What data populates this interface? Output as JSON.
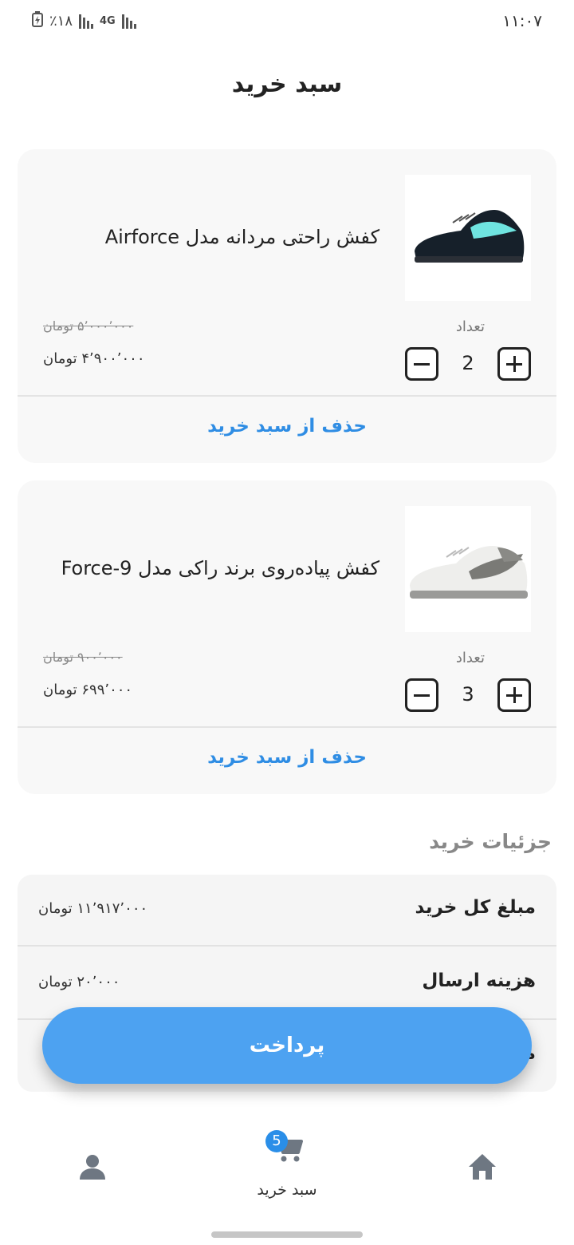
{
  "status_bar": {
    "time": "۱۱:۰۷",
    "battery": "٪۱۸",
    "network": "4G"
  },
  "page_title": "سبد خرید",
  "cart_items": [
    {
      "name": "کفش راحتی مردانه مدل Airforce",
      "quantity_label": "تعداد",
      "quantity": "2",
      "old_price": "۵٬۰۰۰٬۰۰۰ تومان",
      "new_price": "۴٬۹۰۰٬۰۰۰ تومان",
      "remove_label": "حذف از سبد خرید",
      "image_icon": "black-sneaker-icon"
    },
    {
      "name": "کفش پیاده‌روی برند راکی مدل Force-9",
      "quantity_label": "تعداد",
      "quantity": "3",
      "old_price": "۹۰۰٬۰۰۰ تومان",
      "new_price": "۶۹۹٬۰۰۰ تومان",
      "remove_label": "حذف از سبد خرید",
      "image_icon": "white-sneaker-icon"
    }
  ],
  "purchase_details": {
    "title": "جزئیات خرید",
    "rows": [
      {
        "label": "مبلغ کل خرید",
        "value": "۱۱٬۹۱۷٬۰۰۰ تومان"
      },
      {
        "label": "هزینه ارسال",
        "value": "۲۰٬۰۰۰ تومان"
      },
      {
        "label": "م",
        "value": ""
      }
    ]
  },
  "pay_button": "پرداخت",
  "bottom_nav": {
    "cart_label": "سبد خرید",
    "cart_badge": "5",
    "icons": [
      "profile-icon",
      "cart-icon",
      "home-icon"
    ]
  },
  "colors": {
    "accent": "#4da2f1",
    "link": "#2f8de4",
    "badge": "#2a8ee8"
  }
}
